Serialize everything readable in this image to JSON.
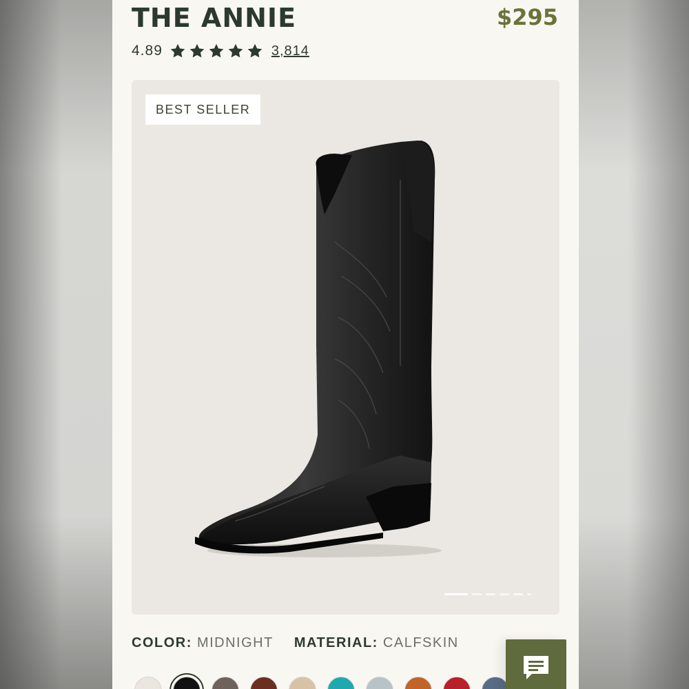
{
  "product": {
    "name": "THE ANNIE",
    "price": "$295",
    "rating": "4.89",
    "star_count": 5,
    "review_count": "3,814",
    "badge": "BEST SELLER"
  },
  "gallery": {
    "image_alt_icon": "boot-image",
    "slide_count": 6,
    "active_slide": 1
  },
  "specs": {
    "color_label": "COLOR:",
    "color_value": "MIDNIGHT",
    "material_label": "MATERIAL:",
    "material_value": "CALFSKIN"
  },
  "swatches": [
    {
      "color": "#ebe7e0",
      "selected": false
    },
    {
      "color": "#111111",
      "selected": true
    },
    {
      "color": "#6e625c",
      "selected": false
    },
    {
      "color": "#6b2f22",
      "selected": false
    },
    {
      "color": "#d8c2a6",
      "selected": false
    },
    {
      "color": "#1fa8b0",
      "selected": false
    },
    {
      "color": "#b8c3c8",
      "selected": false
    },
    {
      "color": "#c0642a",
      "selected": false
    },
    {
      "color": "#b8202a",
      "selected": false
    },
    {
      "color": "#5a6b85",
      "selected": false
    }
  ],
  "colors": {
    "title": "#2c3a2e",
    "price": "#6b7339",
    "chat_button": "#5f6b3d"
  },
  "chat": {
    "icon": "chat-icon"
  }
}
